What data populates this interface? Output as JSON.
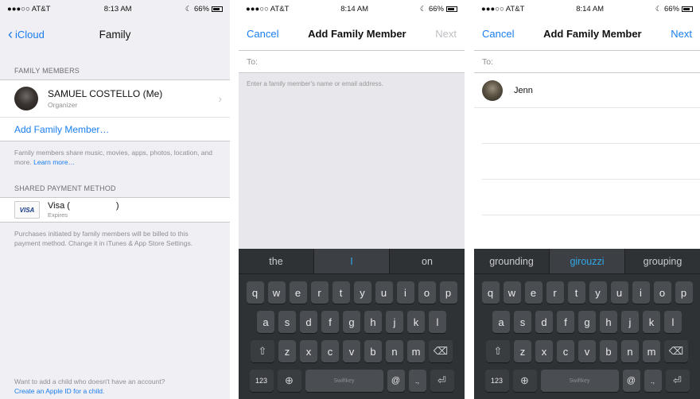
{
  "colors": {
    "accent": "#1a7df0",
    "keyboard_bg": "#2f3235",
    "suggestion_highlight": "#2fa8e8"
  },
  "screen1": {
    "status": {
      "carrier": "●●●○○ AT&T",
      "time": "8:13 AM",
      "battery": "66%"
    },
    "nav": {
      "back_label": "iCloud",
      "title": "Family"
    },
    "members_header": "FAMILY MEMBERS",
    "member": {
      "name": "SAMUEL COSTELLO (Me)",
      "role": "Organizer"
    },
    "add_member": "Add Family Member…",
    "members_footer": "Family members share music, movies, apps, photos, location, and more.",
    "learn_more": "Learn more…",
    "payment_header": "SHARED PAYMENT METHOD",
    "payment": {
      "logo": "VISA",
      "name": "Visa (",
      "name_end": ")",
      "sub": "Expires"
    },
    "payment_footer": "Purchases initiated by family members will be billed to this payment method. Change it in iTunes & App Store Settings.",
    "child_note": "Want to add a child who doesn't have an account?",
    "child_link": "Create an Apple ID for a child."
  },
  "screen2": {
    "status": {
      "carrier": "●●●○○ AT&T",
      "time": "8:14 AM",
      "battery": "66%"
    },
    "nav": {
      "cancel": "Cancel",
      "title": "Add Family Member",
      "next": "Next"
    },
    "to_label": "To:",
    "hint": "Enter a family member's name or email address.",
    "suggestions": [
      "the",
      "I",
      "on"
    ]
  },
  "screen3": {
    "status": {
      "carrier": "●●●○○ AT&T",
      "time": "8:14 AM",
      "battery": "66%"
    },
    "nav": {
      "cancel": "Cancel",
      "title": "Add Family Member",
      "next": "Next"
    },
    "to_label": "To:",
    "contact": "Jenn",
    "suggestions": [
      "grounding",
      "girouzzi",
      "grouping"
    ]
  },
  "keyboard": {
    "row1": [
      "q",
      "w",
      "e",
      "r",
      "t",
      "y",
      "u",
      "i",
      "o",
      "p"
    ],
    "row2": [
      "a",
      "s",
      "d",
      "f",
      "g",
      "h",
      "j",
      "k",
      "l"
    ],
    "row3": [
      "z",
      "x",
      "c",
      "v",
      "b",
      "n",
      "m"
    ],
    "num_key": "123",
    "at_key": "@",
    "space_label": "Swiftkey",
    "icons": {
      "shift": "shift-icon",
      "delete": "backspace-icon",
      "globe": "globe-icon",
      "return": "return-icon"
    }
  }
}
